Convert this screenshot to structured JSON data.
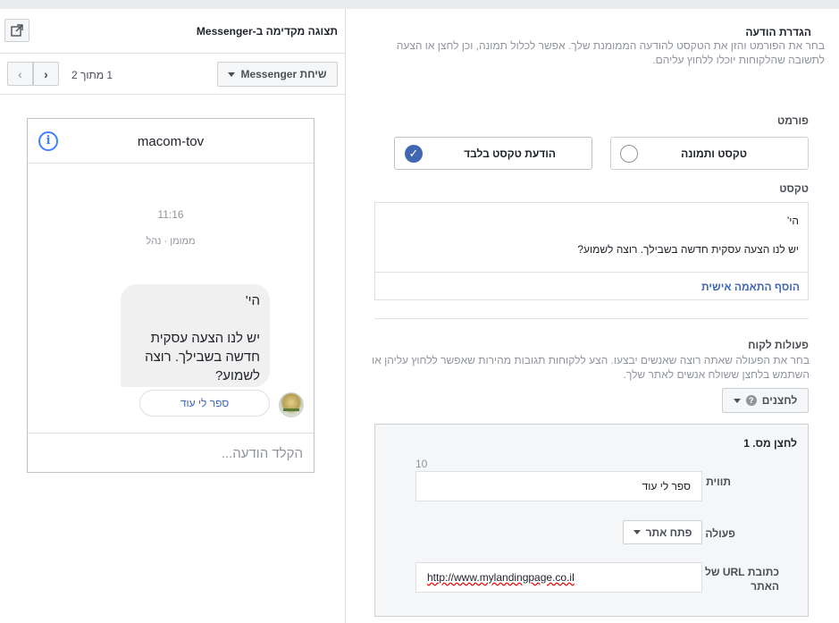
{
  "preview": {
    "title": "תצוגה מקדימה ב-Messenger",
    "mode_label": "שיחת Messenger",
    "page_count": "1 מתוך 2",
    "chat": {
      "page_name": "macom-tov",
      "time": "11:16",
      "sponsored": "ממומן · נהל",
      "message": "הי'\n\nיש לנו הצעה עסקית חדשה בשבילך. רוצה לשמוע?",
      "button_label": "ספר לי עוד",
      "input_placeholder": "הקלד הודעה..."
    }
  },
  "setup": {
    "title": "הגדרת הודעה",
    "description": "בחר את הפורמט והזן את הטקסט להודעה הממומנת שלך. אפשר לכלול תמונה, וכן לחצן או הצעה לתשובה שהלקוחות יוכלו ללחוץ עליהם.",
    "format_label": "פורמט",
    "format_options": [
      {
        "label": "טקסט ותמונה",
        "selected": false
      },
      {
        "label": "הודעת טקסט בלבד",
        "selected": true
      }
    ],
    "text_label": "טקסט",
    "text_value": "הי'\n\nיש לנו הצעה עסקית חדשה בשבילך. רוצה לשמוע?",
    "personalize_link": "הוסף התאמה אישית",
    "customer_actions_label": "פעולות לקוח",
    "customer_actions_desc": "בחר את הפעולה שאתה רוצה שאנשים יבצעו. הצע ללקוחות תגובות מהירות שאפשר ללחוץ עליהן או השתמש בלחצן ששולח אנשים לאתר שלך.",
    "buttons_dropdown": "לחצנים",
    "button_panel": {
      "title": "לחצן מס. 1",
      "label_caption": "תווית",
      "char_count": "10",
      "label_value": "ספר לי עוד",
      "action_caption": "פעולה",
      "action_value": "פתח אתר",
      "url_caption": "כתובת URL של האתר",
      "url_value": "http://www.mylandingpage.co.il"
    }
  },
  "colors": {
    "accent": "#4267b2",
    "info": "#4080ff",
    "border": "#dddfe2",
    "panel_bg": "#f5f6f7"
  },
  "icons": [
    "external-link-icon",
    "chevron-left-icon",
    "chevron-right-icon",
    "info-icon",
    "check-icon",
    "question-icon",
    "caret-down-icon"
  ]
}
